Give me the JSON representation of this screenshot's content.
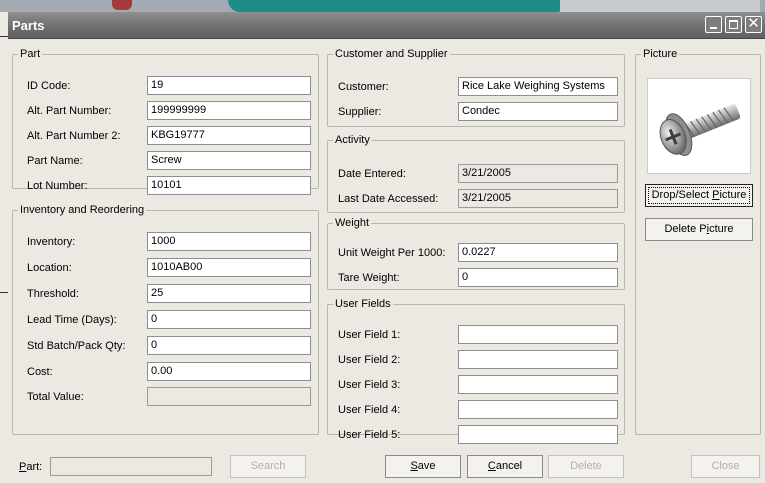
{
  "window": {
    "title": "Parts"
  },
  "title_buttons": {
    "close_glyph": "✕"
  },
  "part": {
    "legend": "Part",
    "fields": [
      {
        "label": "ID Code:",
        "value": "19"
      },
      {
        "label": "Alt. Part Number:",
        "value": "199999999"
      },
      {
        "label": "Alt. Part Number 2:",
        "value": "KBG19777"
      },
      {
        "label": "Part Name:",
        "value": "Screw"
      },
      {
        "label": "Lot Number:",
        "value": "10101"
      }
    ]
  },
  "inventory": {
    "legend": "Inventory and Reordering",
    "fields": [
      {
        "label": "Inventory:",
        "value": "1000"
      },
      {
        "label": "Location:",
        "value": "1010AB00"
      },
      {
        "label": "Threshold:",
        "value": "25"
      },
      {
        "label": "Lead Time (Days):",
        "value": "0"
      },
      {
        "label": "Std Batch/Pack Qty:",
        "value": "0"
      },
      {
        "label": "Cost:",
        "value": "0.00"
      },
      {
        "label": "Total Value:",
        "value": ""
      }
    ]
  },
  "customer": {
    "legend": "Customer and Supplier",
    "fields": [
      {
        "label": "Customer:",
        "value": "Rice Lake Weighing Systems"
      },
      {
        "label": "Supplier:",
        "value": "Condec"
      }
    ]
  },
  "activity": {
    "legend": "Activity",
    "fields": [
      {
        "label": "Date Entered:",
        "value": "3/21/2005"
      },
      {
        "label": "Last Date Accessed:",
        "value": "3/21/2005"
      }
    ]
  },
  "weight": {
    "legend": "Weight",
    "fields": [
      {
        "label": "Unit Weight Per 1000:",
        "value": "0.0227"
      },
      {
        "label": "Tare Weight:",
        "value": "0"
      }
    ]
  },
  "user_fields": {
    "legend": "User Fields",
    "fields": [
      {
        "label": "User Field 1:",
        "value": ""
      },
      {
        "label": "User Field 2:",
        "value": ""
      },
      {
        "label": "User Field 3:",
        "value": ""
      },
      {
        "label": "User Field 4:",
        "value": ""
      },
      {
        "label": "User Field 5:",
        "value": ""
      }
    ]
  },
  "picture": {
    "legend": "Picture",
    "drop_select": {
      "pre": "Drop/Select ",
      "key": "P",
      "post": "icture"
    },
    "delete": {
      "pre": "Delete P",
      "key": "i",
      "post": "cture"
    }
  },
  "bottom": {
    "part_label": {
      "key": "P",
      "post": "art:"
    },
    "part_value": "",
    "search": "Search",
    "save": {
      "key": "S",
      "post": "ave"
    },
    "cancel": {
      "key": "C",
      "post": "ancel"
    },
    "delete": "Delete",
    "close": "Close"
  }
}
